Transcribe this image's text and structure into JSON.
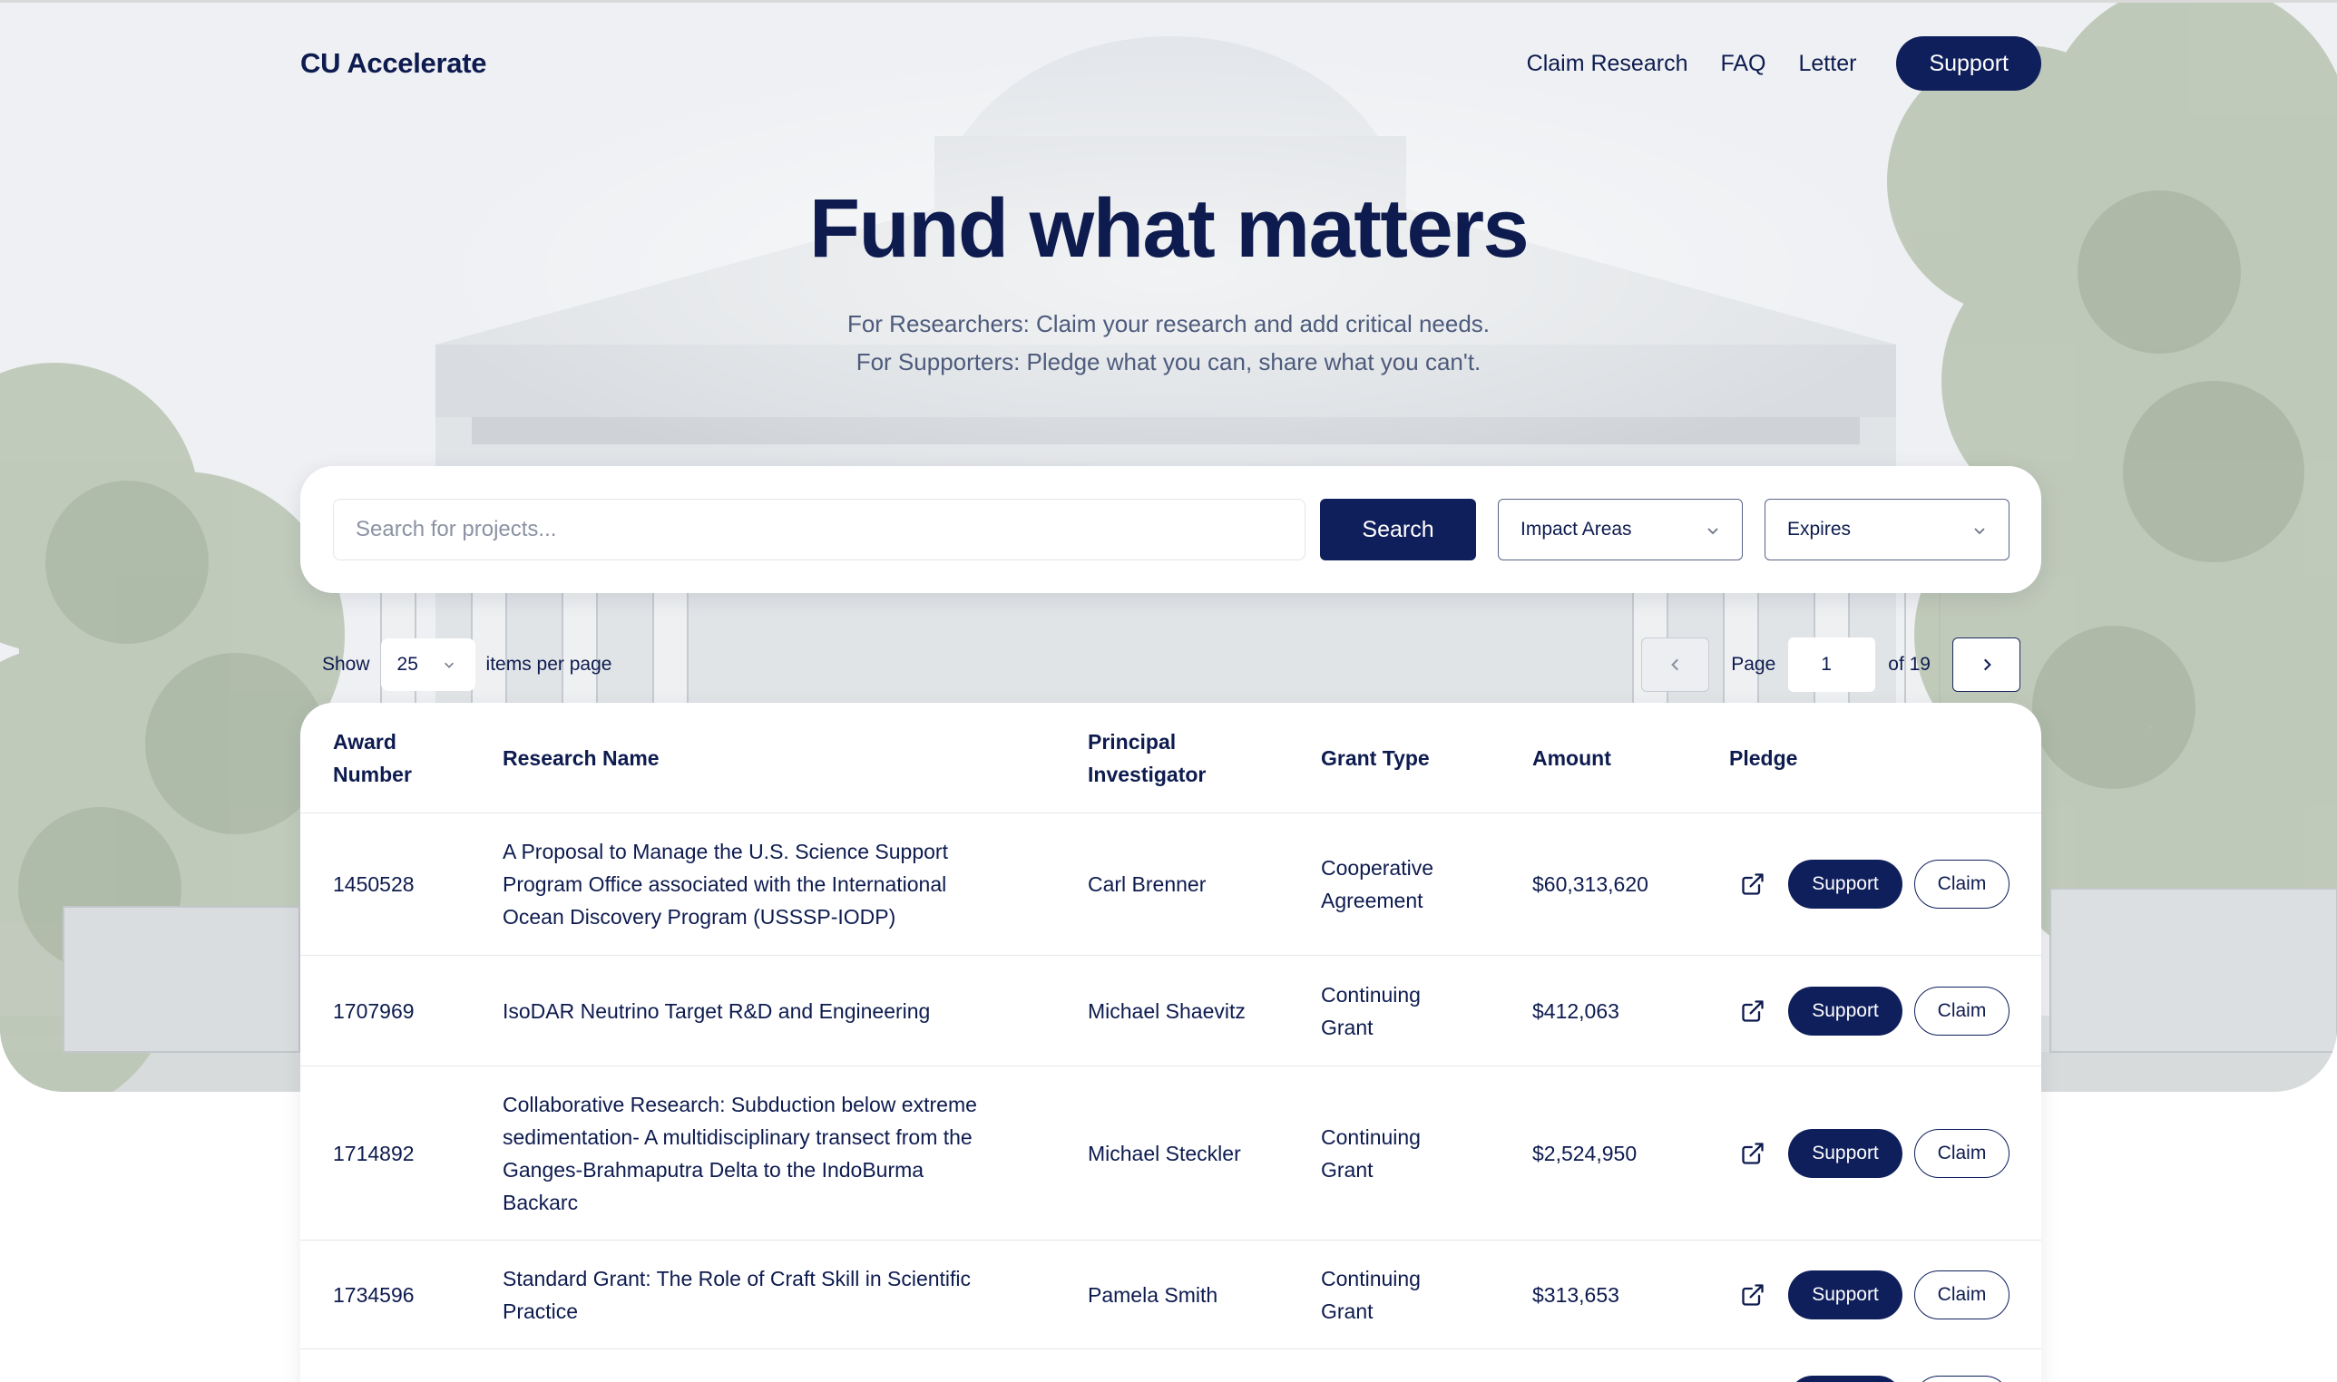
{
  "brand": "CU Accelerate",
  "nav": {
    "links": [
      "Claim Research",
      "FAQ",
      "Letter"
    ],
    "support_label": "Support"
  },
  "hero": {
    "headline": "Fund what matters",
    "subline_1": "For Researchers: Claim your research and add critical needs.",
    "subline_2": "For Supporters: Pledge what you can, share what you can't."
  },
  "search": {
    "placeholder": "Search for projects...",
    "button_label": "Search",
    "filters": [
      "Impact Areas",
      "Expires"
    ]
  },
  "pagination": {
    "show_label": "Show",
    "per_page": "25",
    "per_page_suffix": "items per page",
    "page_label": "Page",
    "page": "1",
    "of_label": "of 19"
  },
  "table": {
    "headers": {
      "award_1": "Award",
      "award_2": "Number",
      "name": "Research Name",
      "pi_1": "Principal",
      "pi_2": "Investigator",
      "grant": "Grant Type",
      "amount": "Amount",
      "pledge": "Pledge"
    },
    "support_label": "Support",
    "claim_label": "Claim",
    "rows": [
      {
        "award": "1450528",
        "name_lines": [
          "A Proposal to Manage the U.S. Science Support",
          "Program Office associated with the International",
          "Ocean Discovery Program (USSSP-IODP)"
        ],
        "pi": "Carl Brenner",
        "grant_lines": [
          "Cooperative",
          "Agreement"
        ],
        "amount": "$60,313,620"
      },
      {
        "award": "1707969",
        "name_lines": [
          "IsoDAR Neutrino Target R&D and Engineering"
        ],
        "pi": "Michael Shaevitz",
        "grant_lines": [
          "Continuing",
          "Grant"
        ],
        "amount": "$412,063"
      },
      {
        "award": "1714892",
        "name_lines": [
          "Collaborative Research: Subduction below extreme",
          "sedimentation- A multidisciplinary transect from the",
          "Ganges-Brahmaputra Delta to the IndoBurma",
          "Backarc"
        ],
        "pi": "Michael Steckler",
        "grant_lines": [
          "Continuing",
          "Grant"
        ],
        "amount": "$2,524,950"
      },
      {
        "award": "1734596",
        "name_lines": [
          "Standard Grant: The Role of Craft Skill in Scientific",
          "Practice"
        ],
        "pi": "Pamela Smith",
        "grant_lines": [
          "Continuing",
          "Grant"
        ],
        "amount": "$313,653"
      }
    ]
  },
  "colors": {
    "navy": "#0f1f5c",
    "text": "#0d1b4f",
    "muted": "#4d5b7c"
  },
  "icons": [
    "chevron-down-icon",
    "chevron-left-icon",
    "chevron-right-icon",
    "external-link-icon"
  ]
}
